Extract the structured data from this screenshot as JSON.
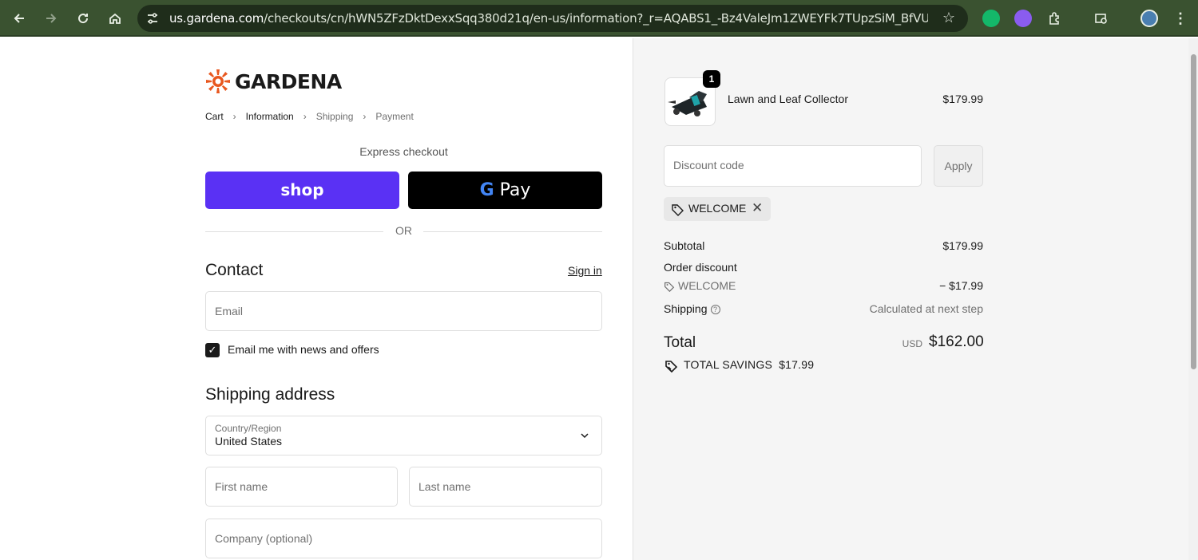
{
  "browser": {
    "url_host": "us.gardena.com",
    "url_path": "/checkouts/cn/hWN5ZFzDktDexxSqq380d21q/en-us/information?_r=AQABS1_-Bz4ValeJm1ZWEYFk7TUpzSiM_BfVUidhLhZ..."
  },
  "brand": {
    "name": "GARDENA",
    "accent": "#e8571e"
  },
  "breadcrumb": {
    "items": [
      "Cart",
      "Information",
      "Shipping",
      "Payment"
    ],
    "active_index": 1
  },
  "express": {
    "title": "Express checkout",
    "shop_label": "shop",
    "gpay_label": "Pay",
    "or_label": "OR",
    "shop_color": "#5a31f4"
  },
  "contact": {
    "title": "Contact",
    "sign_in": "Sign in",
    "email_placeholder": "Email",
    "newsletter_label": "Email me with news and offers",
    "newsletter_checked": true
  },
  "shipping": {
    "title": "Shipping address",
    "country_label": "Country/Region",
    "country_value": "United States",
    "first_name_placeholder": "First name",
    "last_name_placeholder": "Last name",
    "company_placeholder": "Company (optional)"
  },
  "summary": {
    "product": {
      "name": "Lawn and Leaf Collector",
      "price": "$179.99",
      "quantity": "1"
    },
    "discount_placeholder": "Discount code",
    "apply_label": "Apply",
    "applied_code": "WELCOME",
    "subtotal_label": "Subtotal",
    "subtotal_value": "$179.99",
    "order_discount_label": "Order discount",
    "discount_code": "WELCOME",
    "discount_value": "− $17.99",
    "shipping_label": "Shipping",
    "shipping_value": "Calculated at next step",
    "total_label": "Total",
    "currency": "USD",
    "total_value": "$162.00",
    "savings_label": "TOTAL SAVINGS",
    "savings_value": "$17.99"
  }
}
